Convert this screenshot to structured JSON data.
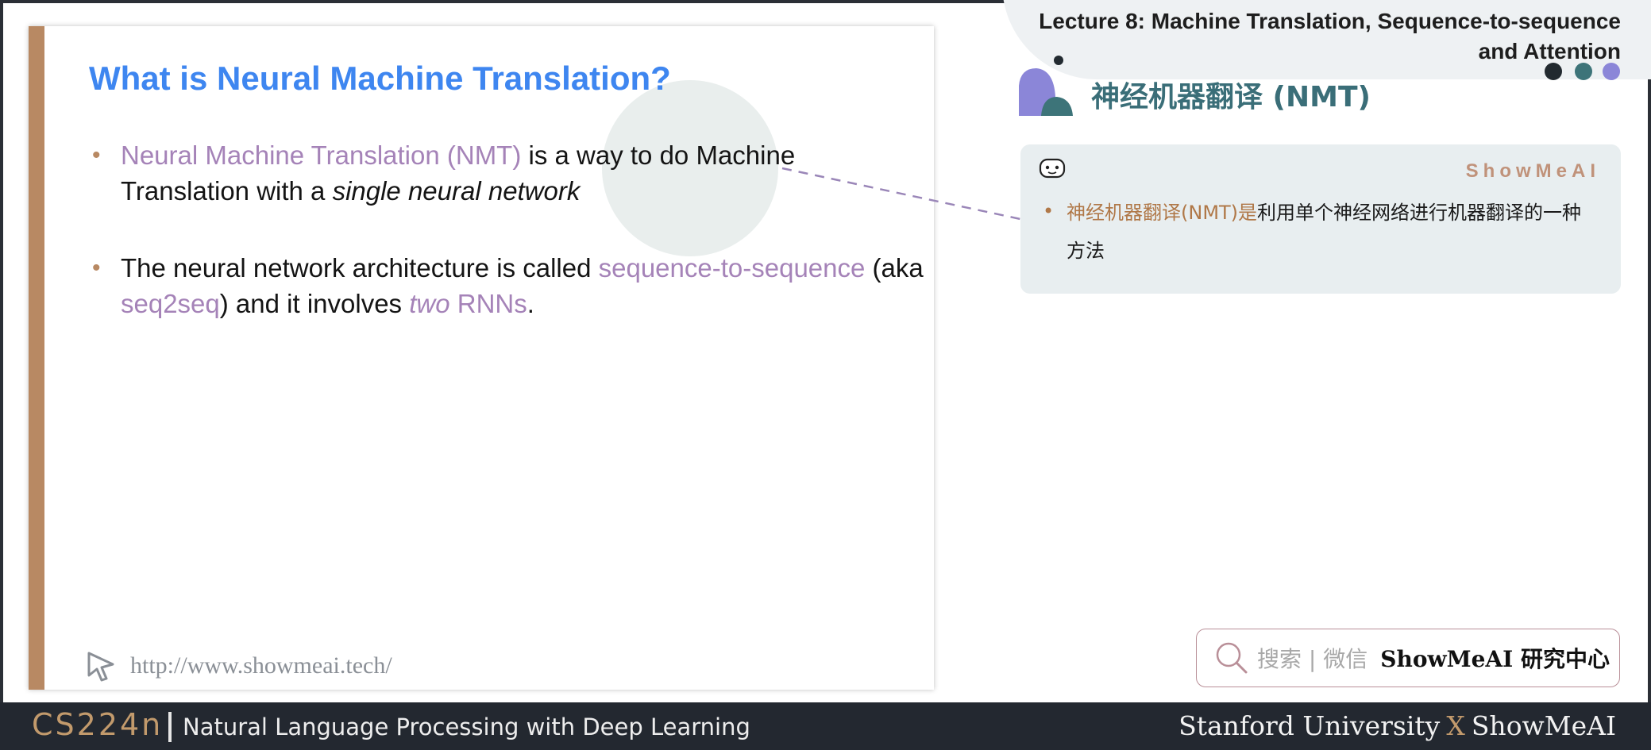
{
  "slide": {
    "title": "What is Neural Machine Translation?",
    "bullet1": {
      "highlight": "Neural Machine Translation (NMT)",
      "text_a": " is a way to do Machine Translation with a ",
      "italic": "single neural network"
    },
    "bullet2": {
      "text_a": "The neural network architecture is called ",
      "highlight_a": "sequence-to-sequence",
      "text_b": " (aka ",
      "highlight_b": "seq2seq",
      "text_c": ") and it involves ",
      "italic": "two",
      "highlight_c": " RNNs",
      "text_d": "."
    },
    "url": "http://www.showmeai.tech/"
  },
  "header": {
    "lecture_line1": "Lecture 8:  Machine Translation, Sequence-to-sequence",
    "lecture_line2": "and Attention",
    "section_title": "神经机器翻译 (NMT)"
  },
  "note": {
    "brand": "ShowMeAI",
    "highlight": "神经机器翻译(NMT)是",
    "text": "利用单个神经网络进行机器翻译的一种方法"
  },
  "search": {
    "hint": "搜索 | 微信",
    "brand": "ShowMeAI 研究中心"
  },
  "footer": {
    "course": "CS224n",
    "course_title": "Natural Language Processing with Deep Learning",
    "credit_a": "Stanford University",
    "credit_x": "X",
    "credit_b": "ShowMeAI"
  },
  "colors": {
    "title_blue": "#3e86f0",
    "highlight_purple": "#a583b8",
    "accent_brown": "#b88963",
    "section_teal": "#3a6e78",
    "footer_bg": "#232830"
  },
  "icons": [
    "cursor-click-icon",
    "search-icon",
    "robot-icon"
  ]
}
